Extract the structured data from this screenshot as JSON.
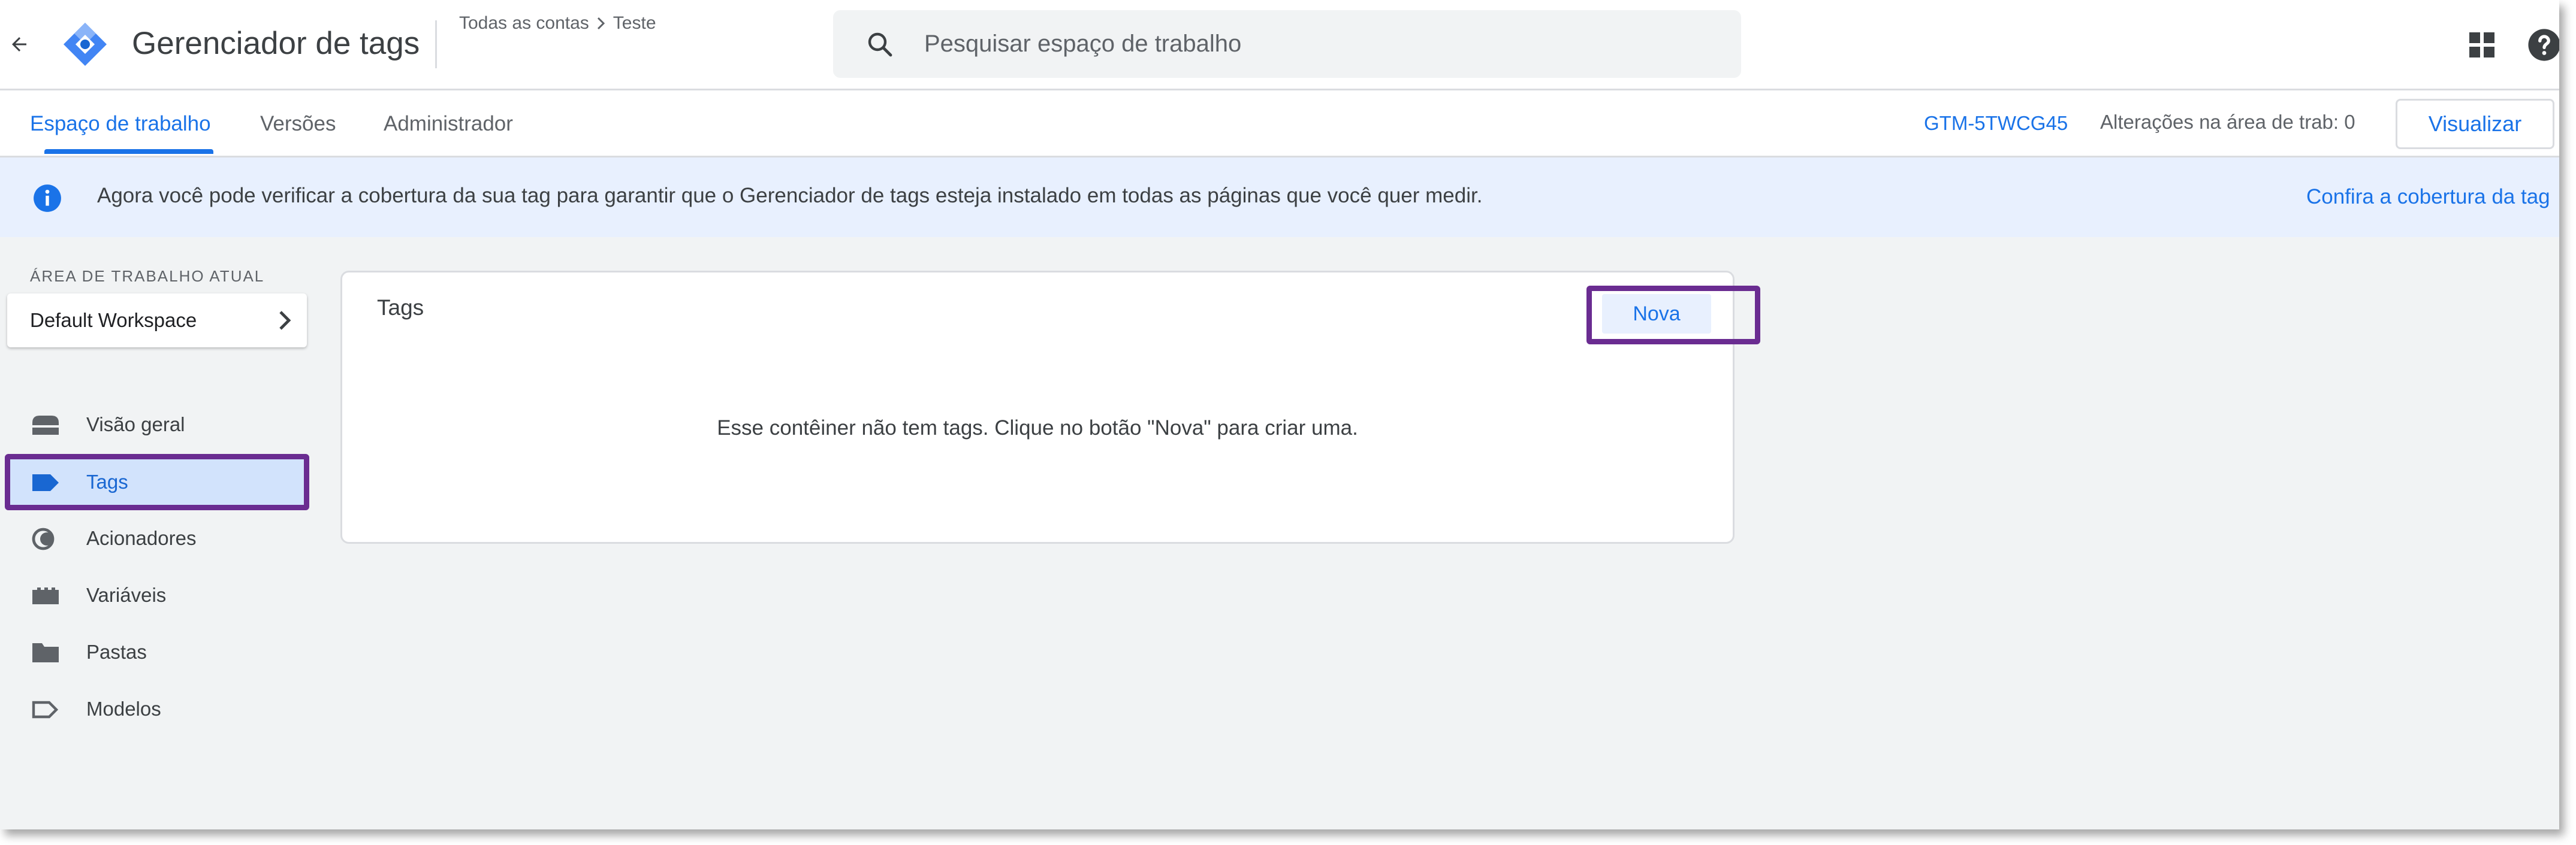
{
  "header": {
    "app_title": "Gerenciador de tags",
    "breadcrumb": {
      "account": "Todas as contas",
      "container": "Teste"
    },
    "search": {
      "placeholder": "Pesquisar espaço de trabalho"
    }
  },
  "tabs": [
    {
      "label": "Espaço de trabalho",
      "active": true
    },
    {
      "label": "Versões",
      "active": false
    },
    {
      "label": "Administrador",
      "active": false
    }
  ],
  "toolbar": {
    "container_id": "GTM-5TWCG45",
    "changes": "Alterações na área de trab: 0",
    "preview_label": "Visualizar"
  },
  "banner": {
    "text": "Agora você pode verificar a cobertura da sua tag para garantir que o Gerenciador de tags esteja instalado em todas as páginas que você quer medir.",
    "link": "Confira a cobertura da tag"
  },
  "workspace": {
    "label": "ÁREA DE TRABALHO ATUAL",
    "name": "Default Workspace"
  },
  "sidebar": {
    "items": [
      {
        "label": "Visão geral",
        "icon": "overview-icon"
      },
      {
        "label": "Tags",
        "icon": "tag-icon",
        "active": true
      },
      {
        "label": "Acionadores",
        "icon": "trigger-icon"
      },
      {
        "label": "Variáveis",
        "icon": "variables-icon"
      },
      {
        "label": "Pastas",
        "icon": "folder-icon"
      },
      {
        "label": "Modelos",
        "icon": "template-icon"
      }
    ]
  },
  "tags_panel": {
    "title": "Tags",
    "new_label": "Nova",
    "empty_message": "Esse contêiner não tem tags. Clique no botão \"Nova\" para criar uma."
  },
  "colors": {
    "accent": "#1a73e8",
    "highlight": "#6a2c91",
    "banner_bg": "#e8f0fe",
    "active_nav_bg": "#d2e3fc"
  }
}
